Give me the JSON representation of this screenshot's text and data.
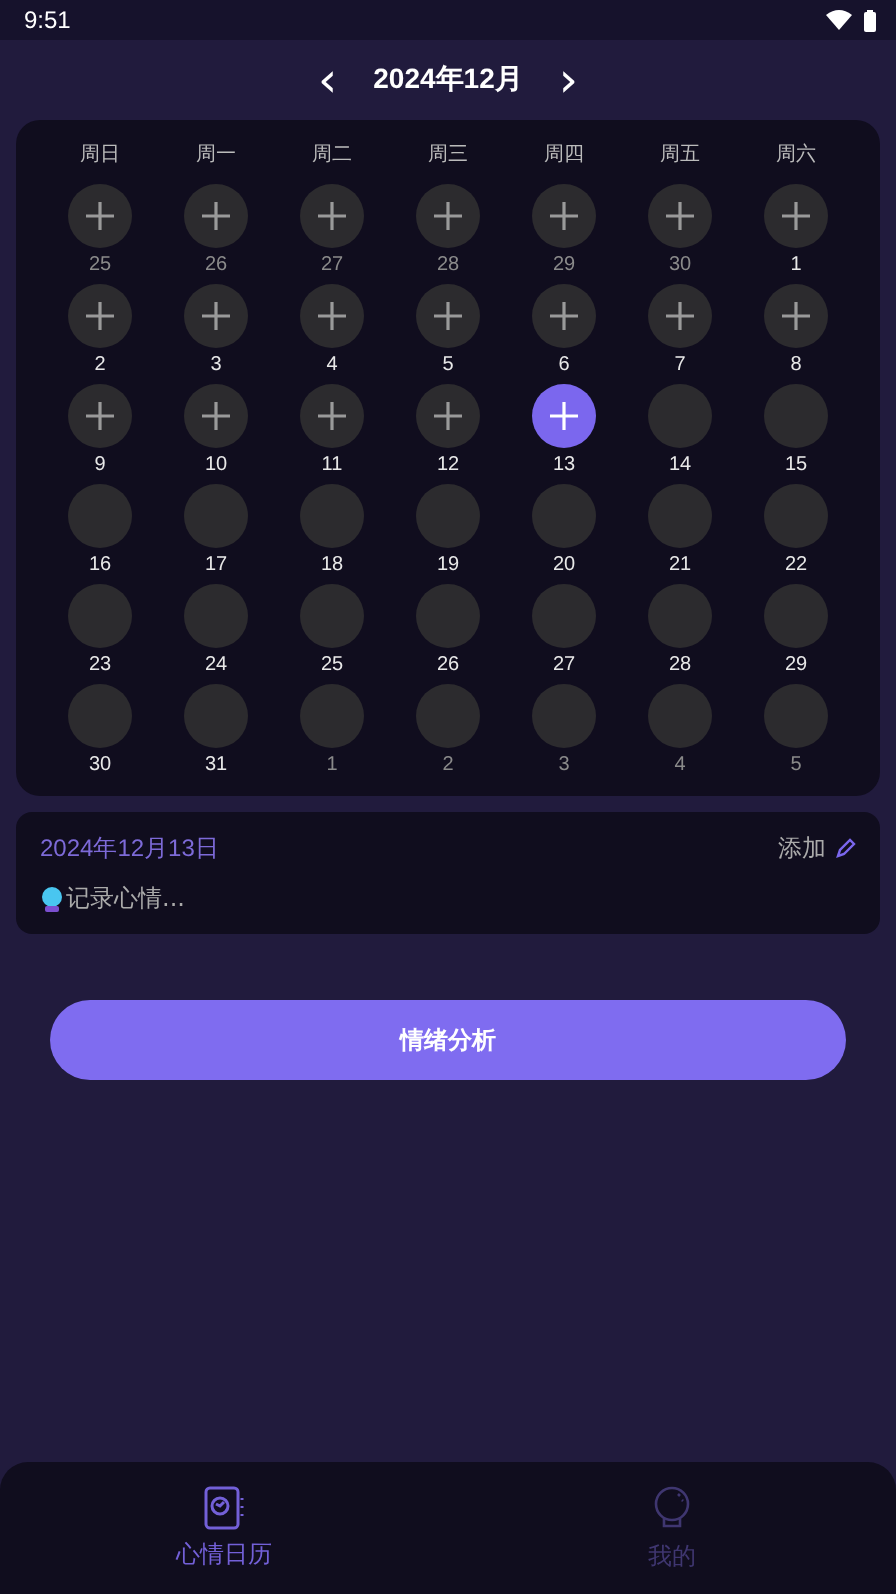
{
  "status_bar": {
    "time": "9:51"
  },
  "header": {
    "prev": "‹",
    "title": "2024年12月",
    "next": "›"
  },
  "calendar": {
    "weekdays": [
      "周日",
      "周一",
      "周二",
      "周三",
      "周四",
      "周五",
      "周六"
    ],
    "days": [
      {
        "label": "25",
        "in_month": false,
        "kind": "add",
        "selected": false
      },
      {
        "label": "26",
        "in_month": false,
        "kind": "add",
        "selected": false
      },
      {
        "label": "27",
        "in_month": false,
        "kind": "add",
        "selected": false
      },
      {
        "label": "28",
        "in_month": false,
        "kind": "add",
        "selected": false
      },
      {
        "label": "29",
        "in_month": false,
        "kind": "add",
        "selected": false
      },
      {
        "label": "30",
        "in_month": false,
        "kind": "add",
        "selected": false
      },
      {
        "label": "1",
        "in_month": true,
        "kind": "add",
        "selected": false
      },
      {
        "label": "2",
        "in_month": true,
        "kind": "add",
        "selected": false
      },
      {
        "label": "3",
        "in_month": true,
        "kind": "add",
        "selected": false
      },
      {
        "label": "4",
        "in_month": true,
        "kind": "add",
        "selected": false
      },
      {
        "label": "5",
        "in_month": true,
        "kind": "add",
        "selected": false
      },
      {
        "label": "6",
        "in_month": true,
        "kind": "add",
        "selected": false
      },
      {
        "label": "7",
        "in_month": true,
        "kind": "add",
        "selected": false
      },
      {
        "label": "8",
        "in_month": true,
        "kind": "add",
        "selected": false
      },
      {
        "label": "9",
        "in_month": true,
        "kind": "add",
        "selected": false
      },
      {
        "label": "10",
        "in_month": true,
        "kind": "add",
        "selected": false
      },
      {
        "label": "11",
        "in_month": true,
        "kind": "add",
        "selected": false
      },
      {
        "label": "12",
        "in_month": true,
        "kind": "add",
        "selected": false
      },
      {
        "label": "13",
        "in_month": true,
        "kind": "add",
        "selected": true
      },
      {
        "label": "14",
        "in_month": true,
        "kind": "empty",
        "selected": false
      },
      {
        "label": "15",
        "in_month": true,
        "kind": "empty",
        "selected": false
      },
      {
        "label": "16",
        "in_month": true,
        "kind": "empty",
        "selected": false
      },
      {
        "label": "17",
        "in_month": true,
        "kind": "empty",
        "selected": false
      },
      {
        "label": "18",
        "in_month": true,
        "kind": "empty",
        "selected": false
      },
      {
        "label": "19",
        "in_month": true,
        "kind": "empty",
        "selected": false
      },
      {
        "label": "20",
        "in_month": true,
        "kind": "empty",
        "selected": false
      },
      {
        "label": "21",
        "in_month": true,
        "kind": "empty",
        "selected": false
      },
      {
        "label": "22",
        "in_month": true,
        "kind": "empty",
        "selected": false
      },
      {
        "label": "23",
        "in_month": true,
        "kind": "empty",
        "selected": false
      },
      {
        "label": "24",
        "in_month": true,
        "kind": "empty",
        "selected": false
      },
      {
        "label": "25",
        "in_month": true,
        "kind": "empty",
        "selected": false
      },
      {
        "label": "26",
        "in_month": true,
        "kind": "empty",
        "selected": false
      },
      {
        "label": "27",
        "in_month": true,
        "kind": "empty",
        "selected": false
      },
      {
        "label": "28",
        "in_month": true,
        "kind": "empty",
        "selected": false
      },
      {
        "label": "29",
        "in_month": true,
        "kind": "empty",
        "selected": false
      },
      {
        "label": "30",
        "in_month": true,
        "kind": "empty",
        "selected": false
      },
      {
        "label": "31",
        "in_month": true,
        "kind": "empty",
        "selected": false
      },
      {
        "label": "1",
        "in_month": false,
        "kind": "empty",
        "selected": false
      },
      {
        "label": "2",
        "in_month": false,
        "kind": "empty",
        "selected": false
      },
      {
        "label": "3",
        "in_month": false,
        "kind": "empty",
        "selected": false
      },
      {
        "label": "4",
        "in_month": false,
        "kind": "empty",
        "selected": false
      },
      {
        "label": "5",
        "in_month": false,
        "kind": "empty",
        "selected": false
      }
    ]
  },
  "note": {
    "date": "2024年12月13日",
    "add_label": "添加",
    "placeholder": "记录心情..."
  },
  "analyze_button": "情绪分析",
  "tabs": [
    {
      "label": "心情日历",
      "selected": true
    },
    {
      "label": "我的",
      "selected": false
    }
  ]
}
